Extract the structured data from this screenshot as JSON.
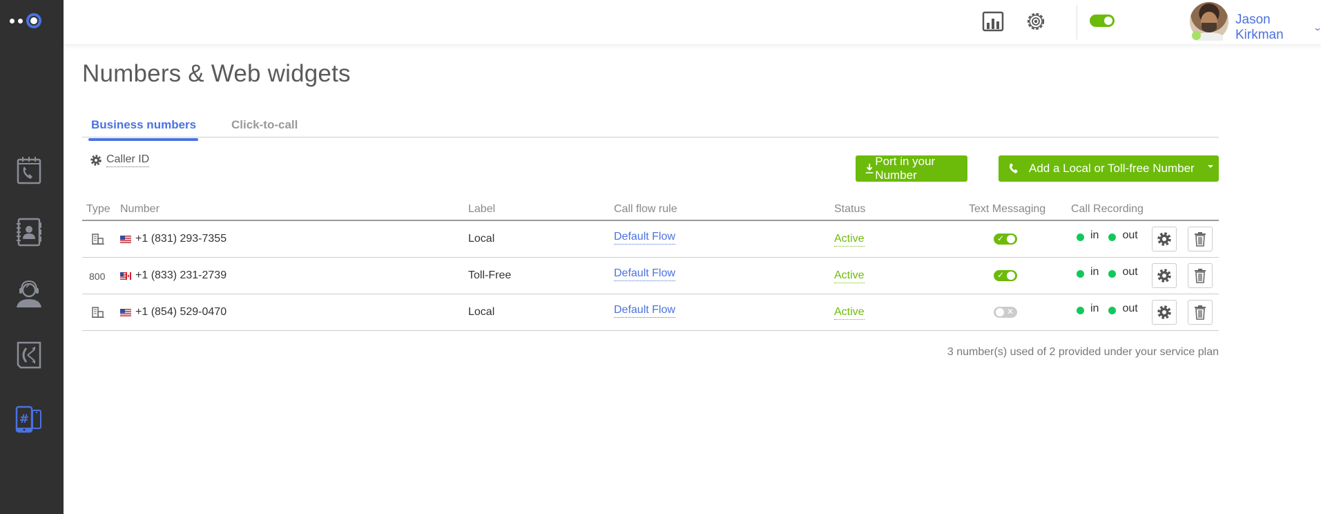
{
  "header": {
    "user_name": "Jason Kirkman",
    "icons": [
      "analytics-icon",
      "settings-icon",
      "availability-toggle",
      "avatar",
      "dialpad-icon"
    ],
    "availability": "on",
    "presence_color": "#a8e065"
  },
  "sidebar": {
    "items": [
      {
        "name": "call-history",
        "icon": "calendar-phone-icon",
        "active": false
      },
      {
        "name": "contacts",
        "icon": "address-book-icon",
        "active": false
      },
      {
        "name": "agents",
        "icon": "headset-agent-icon",
        "active": false
      },
      {
        "name": "call-flows",
        "icon": "call-flow-icon",
        "active": false
      },
      {
        "name": "numbers",
        "icon": "phone-number-icon",
        "active": true
      }
    ],
    "accent": "#4a72e0"
  },
  "page": {
    "title": "Numbers & Web widgets",
    "tabs": [
      {
        "label": "Business numbers",
        "active": true
      },
      {
        "label": "Click-to-call",
        "active": false
      }
    ],
    "caller_id_label": "Caller ID",
    "buttons": {
      "port": "Port in your Number",
      "add": "Add a Local or Toll-free Number"
    }
  },
  "table": {
    "columns": [
      "Type",
      "Number",
      "Label",
      "Call flow rule",
      "Status",
      "Text Messaging",
      "Call Recording"
    ],
    "rows": [
      {
        "type": "local",
        "type_label": "",
        "flag": "us",
        "number": "+1 (831) 293-7355",
        "label": "Local",
        "flow": "Default Flow",
        "status": "Active",
        "sms": true,
        "rec_in": "in",
        "rec_out": "out"
      },
      {
        "type": "toll-free",
        "type_label": "800",
        "flag": "us-ca",
        "number": "+1 (833) 231-2739",
        "label": "Toll-Free",
        "flow": "Default Flow",
        "status": "Active",
        "sms": true,
        "rec_in": "in",
        "rec_out": "out"
      },
      {
        "type": "local",
        "type_label": "",
        "flag": "us",
        "number": "+1 (854) 529-0470",
        "label": "Local",
        "flow": "Default Flow",
        "status": "Active",
        "sms": false,
        "rec_in": "in",
        "rec_out": "out"
      }
    ]
  },
  "footer_note": "3 number(s) used of 2 provided under your service plan",
  "colors": {
    "primary": "#4a72e0",
    "success": "#6cbb0a",
    "recording_dot": "#12c85b",
    "sidebar_bg": "#303030"
  }
}
